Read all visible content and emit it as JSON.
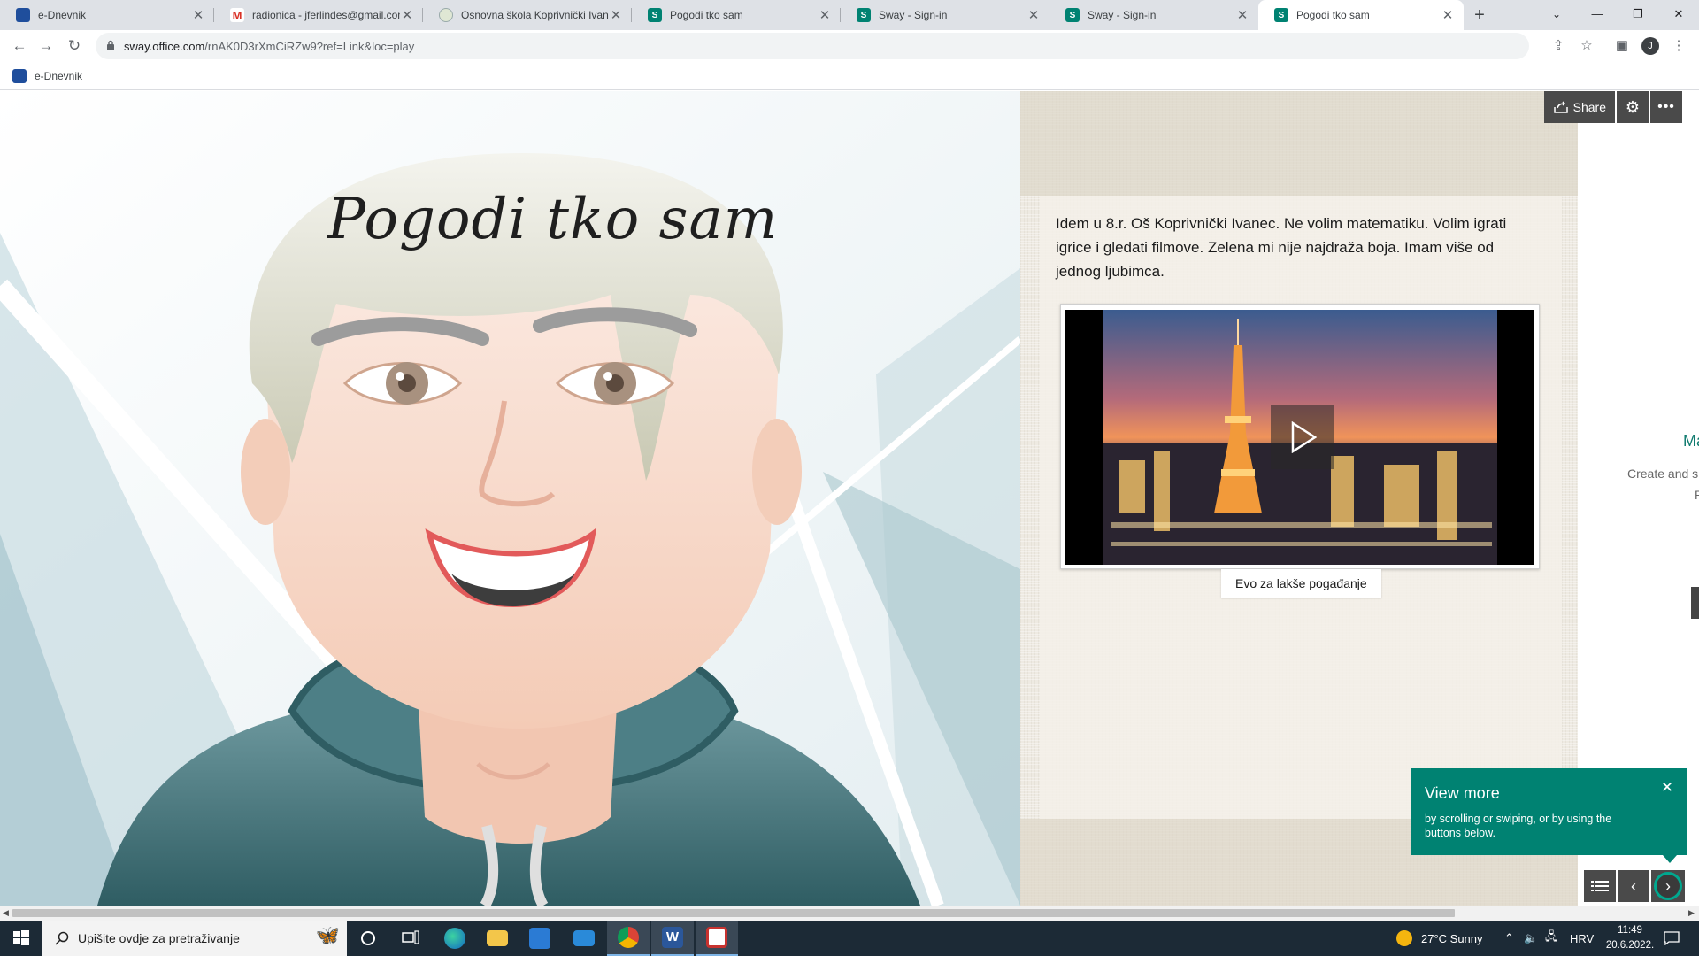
{
  "browser": {
    "tabs": [
      {
        "title": "e-Dnevnik",
        "icon": "e-dnevnik-favicon"
      },
      {
        "title": "radionica - jferlindes@gmail.com",
        "icon": "gmail-favicon"
      },
      {
        "title": "Osnovna škola Koprivnički Ivanec",
        "icon": "school-favicon"
      },
      {
        "title": "Pogodi tko sam",
        "icon": "sway-favicon"
      },
      {
        "title": "Sway - Sign-in",
        "icon": "sway-favicon"
      },
      {
        "title": "Sway - Sign-in",
        "icon": "sway-favicon"
      },
      {
        "title": "Pogodi tko sam",
        "icon": "sway-favicon",
        "active": true
      }
    ],
    "url_host": "sway.office.com",
    "url_path": "/rnAK0D3rXmCiRZw9?ref=Link&loc=play",
    "profile_initial": "J",
    "bookmarks": [
      {
        "label": "e-Dnevnik"
      }
    ]
  },
  "sway": {
    "title": "Pogodi tko sam",
    "description": "Idem u 8.r.  Oš Koprivnički Ivanec. Ne volim matematiku. Volim igrati igrice i gledati filmove. Zelena mi nije najdraža boja. Imam više od jednog ljubimca.",
    "video_caption": "Evo za lakše pogađanje",
    "share_label": "Share",
    "view_more": {
      "title": "View more",
      "text": "by scrolling or swiping, or by using the buttons below."
    },
    "side_panel": {
      "title": "Ma",
      "subtitle": "Create and s",
      "subtitle2": "P"
    },
    "accent_color": "#008272"
  },
  "taskbar": {
    "search_placeholder": "Upišite ovdje za pretraživanje",
    "weather": "27°C  Sunny",
    "language": "HRV",
    "time": "11:49",
    "date": "20.6.2022."
  }
}
